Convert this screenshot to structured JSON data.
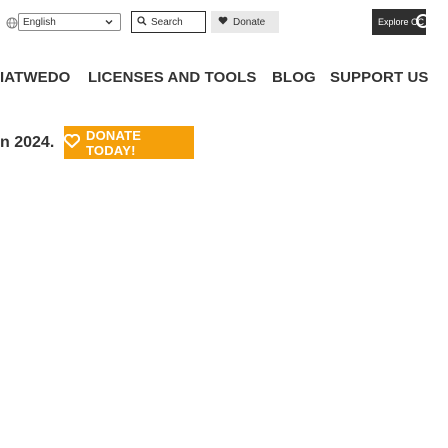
{
  "topbar": {
    "language_selected": "English",
    "search_label": "Search",
    "donate_label": "Donate",
    "explore_label": "Explore CC"
  },
  "nav": {
    "items": [
      "IATWEDO",
      "LICENSES AND TOOLS",
      "BLOG",
      "SUPPORT US"
    ]
  },
  "hero": {
    "text": "n 2024.",
    "cta_label": "DONATE TODAY!"
  },
  "colors": {
    "accent": "#f5a00a",
    "dark": "#2f2f2f",
    "text": "#333333",
    "donate_bg": "#e9e9e9"
  },
  "icons": [
    "globe-icon",
    "chevron-down-icon",
    "search-icon",
    "heart-icon",
    "cc-logo-icon"
  ]
}
